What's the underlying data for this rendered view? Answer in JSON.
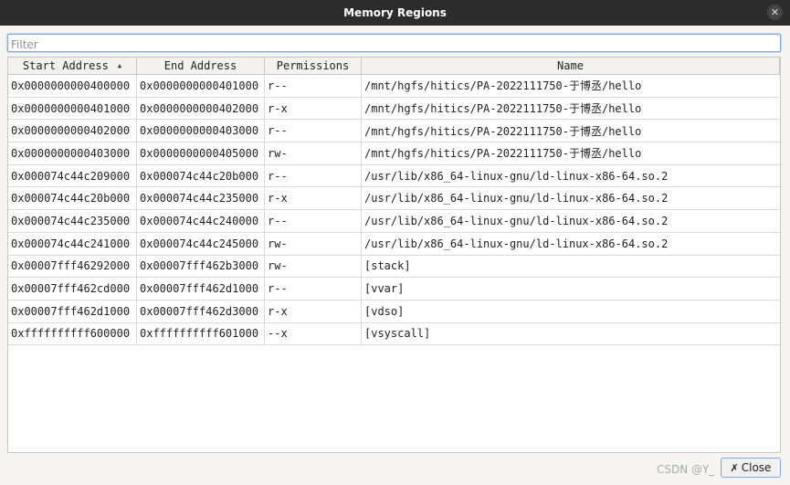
{
  "window": {
    "title": "Memory Regions",
    "close_glyph": "✕"
  },
  "filter": {
    "placeholder": "Filter",
    "value": ""
  },
  "table": {
    "columns": [
      "Start Address",
      "End Address",
      "Permissions",
      "Name"
    ],
    "sort_indicator": "▲",
    "rows": [
      [
        "0x0000000000400000",
        "0x0000000000401000",
        "r--",
        "/mnt/hgfs/hitics/PA-2022111750-于博丞/hello"
      ],
      [
        "0x0000000000401000",
        "0x0000000000402000",
        "r-x",
        "/mnt/hgfs/hitics/PA-2022111750-于博丞/hello"
      ],
      [
        "0x0000000000402000",
        "0x0000000000403000",
        "r--",
        "/mnt/hgfs/hitics/PA-2022111750-于博丞/hello"
      ],
      [
        "0x0000000000403000",
        "0x0000000000405000",
        "rw-",
        "/mnt/hgfs/hitics/PA-2022111750-于博丞/hello"
      ],
      [
        "0x000074c44c209000",
        "0x000074c44c20b000",
        "r--",
        "/usr/lib/x86_64-linux-gnu/ld-linux-x86-64.so.2"
      ],
      [
        "0x000074c44c20b000",
        "0x000074c44c235000",
        "r-x",
        "/usr/lib/x86_64-linux-gnu/ld-linux-x86-64.so.2"
      ],
      [
        "0x000074c44c235000",
        "0x000074c44c240000",
        "r--",
        "/usr/lib/x86_64-linux-gnu/ld-linux-x86-64.so.2"
      ],
      [
        "0x000074c44c241000",
        "0x000074c44c245000",
        "rw-",
        "/usr/lib/x86_64-linux-gnu/ld-linux-x86-64.so.2"
      ],
      [
        "0x00007fff46292000",
        "0x00007fff462b3000",
        "rw-",
        "[stack]"
      ],
      [
        "0x00007fff462cd000",
        "0x00007fff462d1000",
        "r--",
        "[vvar]"
      ],
      [
        "0x00007fff462d1000",
        "0x00007fff462d3000",
        "r-x",
        "[vdso]"
      ],
      [
        "0xffffffffff600000",
        "0xffffffffff601000",
        "--x",
        "[vsyscall]"
      ]
    ]
  },
  "footer": {
    "close_label": "Close",
    "close_icon": "✗",
    "watermark": "CSDN @Y_"
  }
}
